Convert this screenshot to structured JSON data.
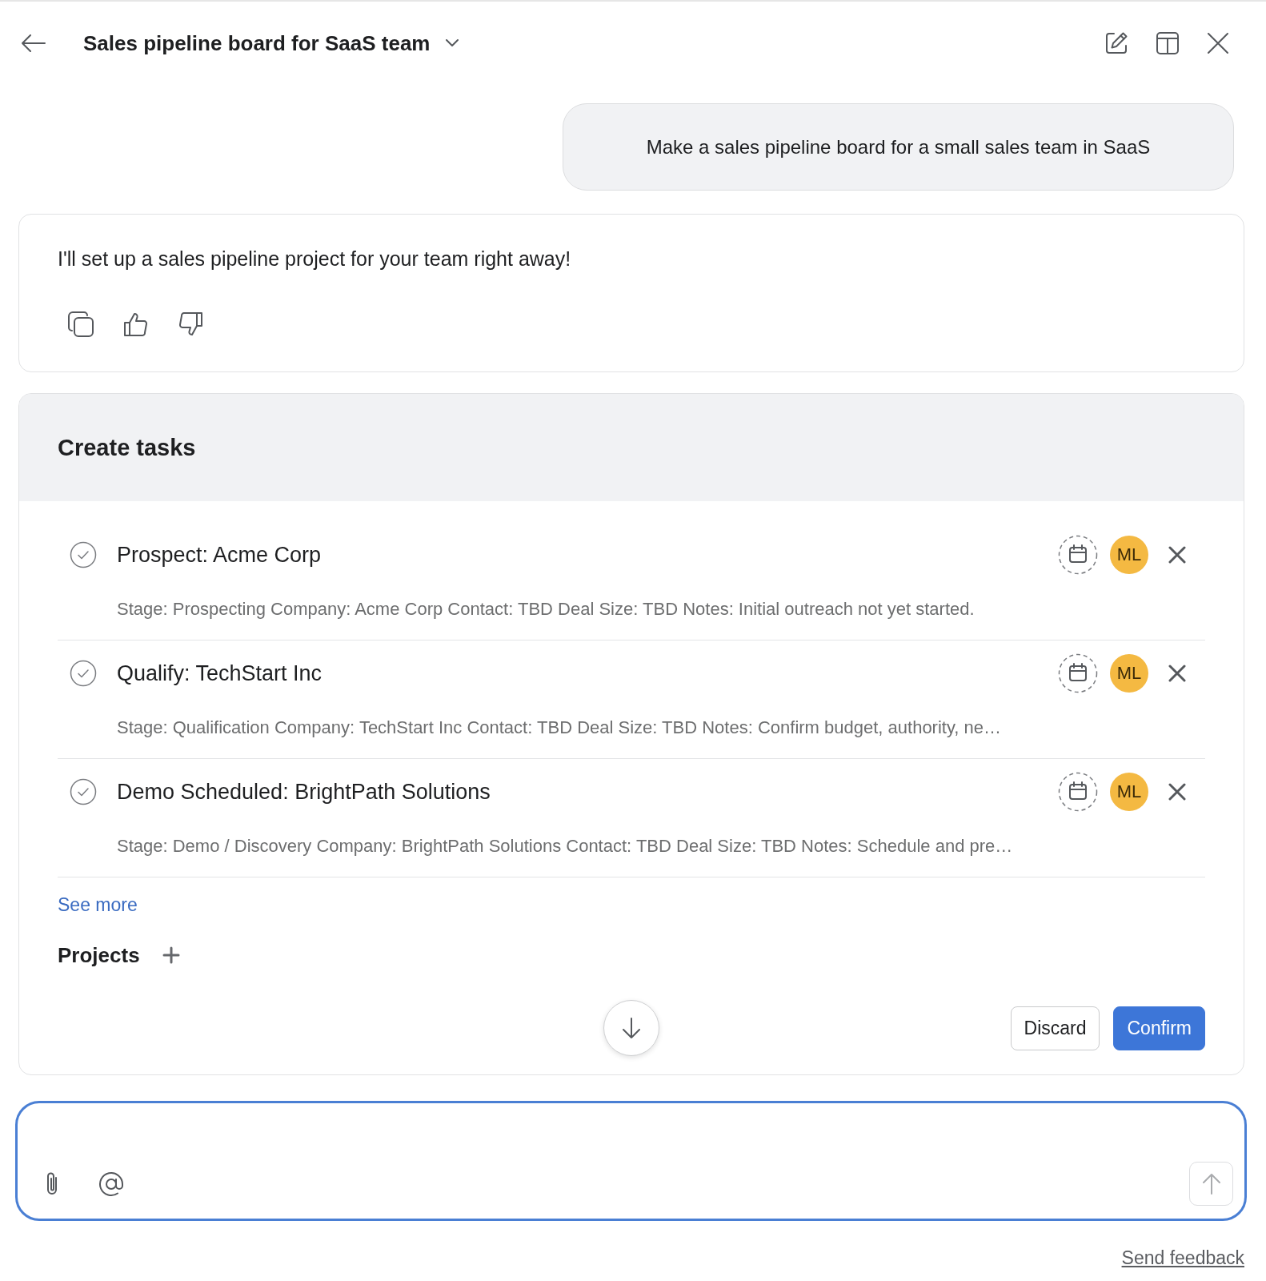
{
  "header": {
    "title": "Sales pipeline board for SaaS team"
  },
  "user_message": {
    "text": "Make a sales pipeline board for a small sales team in SaaS"
  },
  "assistant_message": {
    "text": "I'll set up a sales pipeline project for your team right away!"
  },
  "task_card": {
    "title": "Create tasks",
    "tasks": [
      {
        "title": "Prospect: Acme Corp",
        "description": "Stage: Prospecting Company: Acme Corp Contact: TBD Deal Size: TBD Notes: Initial outreach not yet started.",
        "completed": false,
        "assignee": "ML"
      },
      {
        "title": "Qualify: TechStart Inc",
        "description": "Stage: Qualification Company: TechStart Inc Contact: TBD Deal Size: TBD Notes: Confirm budget, authority, ne…",
        "completed": false,
        "assignee": "ML"
      },
      {
        "title": "Demo Scheduled: BrightPath Solutions",
        "description": "Stage: Demo / Discovery Company: BrightPath Solutions Contact: TBD Deal Size: TBD Notes: Schedule and pre…",
        "completed": false,
        "assignee": "ML"
      }
    ],
    "see_more": "See more",
    "projects_label": "Projects",
    "buttons": [
      {
        "label": "Discard",
        "kind": "secondary"
      },
      {
        "label": "Confirm",
        "kind": "primary"
      }
    ]
  },
  "composer": {
    "send_disabled": true
  },
  "footer": {
    "feedback_link": "Send feedback"
  }
}
